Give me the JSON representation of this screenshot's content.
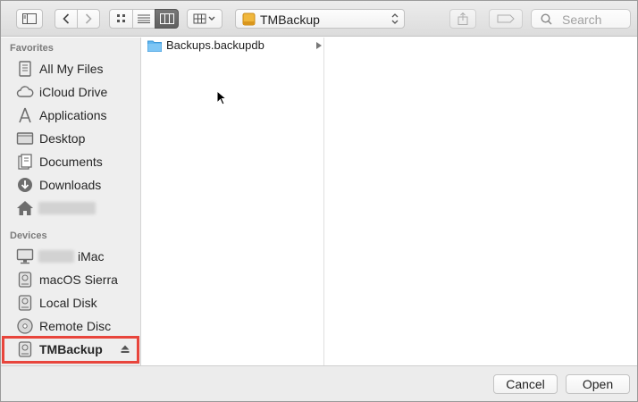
{
  "toolbar": {
    "path_popup_label": "TMBackup",
    "search_placeholder": "Search"
  },
  "sidebar": {
    "favorites_header": "Favorites",
    "favorites": [
      {
        "label": "All My Files",
        "icon": "all-files-icon"
      },
      {
        "label": "iCloud Drive",
        "icon": "cloud-icon"
      },
      {
        "label": "Applications",
        "icon": "applications-icon"
      },
      {
        "label": "Desktop",
        "icon": "desktop-icon"
      },
      {
        "label": "Documents",
        "icon": "documents-icon"
      },
      {
        "label": "Downloads",
        "icon": "downloads-icon"
      },
      {
        "label": "",
        "icon": "home-icon",
        "redacted": true
      }
    ],
    "devices_header": "Devices",
    "devices": [
      {
        "label": "iMac",
        "icon": "imac-icon",
        "redacted_prefix": true
      },
      {
        "label": "macOS Sierra",
        "icon": "disk-icon"
      },
      {
        "label": "Local Disk",
        "icon": "disk-icon"
      },
      {
        "label": "Remote Disc",
        "icon": "optical-disc-icon"
      },
      {
        "label": "TMBackup",
        "icon": "disk-icon",
        "selected": true,
        "ejectable": true
      }
    ]
  },
  "browser": {
    "column1": [
      {
        "name": "Backups.backupdb",
        "type": "folder",
        "has_children": true
      }
    ]
  },
  "buttons": {
    "cancel": "Cancel",
    "open": "Open"
  },
  "colors": {
    "highlight_border": "#e8453c",
    "folder_blue": "#5fb6f0"
  }
}
